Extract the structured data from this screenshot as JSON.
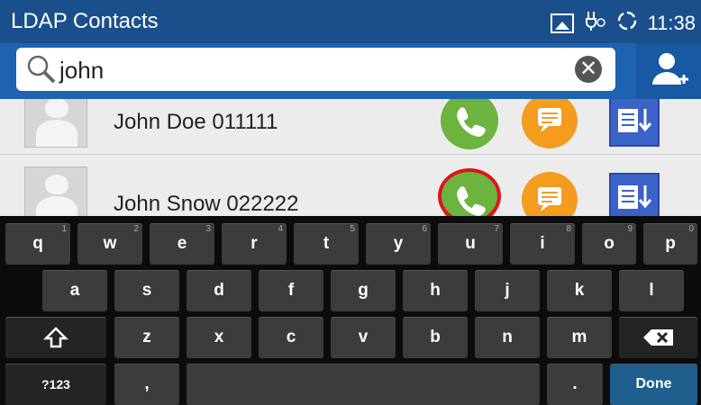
{
  "status_bar": {
    "title": "LDAP Contacts",
    "time": "11:38"
  },
  "search": {
    "query": "john"
  },
  "contacts": [
    {
      "name": "John Doe 011111"
    },
    {
      "name": "John Snow 022222"
    }
  ],
  "keyboard": {
    "row1": [
      {
        "label": "q",
        "hint": "1"
      },
      {
        "label": "w",
        "hint": "2"
      },
      {
        "label": "e",
        "hint": "3"
      },
      {
        "label": "r",
        "hint": "4"
      },
      {
        "label": "t",
        "hint": "5"
      },
      {
        "label": "y",
        "hint": "6"
      },
      {
        "label": "u",
        "hint": "7"
      },
      {
        "label": "i",
        "hint": "8"
      },
      {
        "label": "o",
        "hint": "9"
      },
      {
        "label": "p",
        "hint": "0"
      }
    ],
    "row2": [
      "a",
      "s",
      "d",
      "f",
      "g",
      "h",
      "j",
      "k",
      "l"
    ],
    "row3": [
      "z",
      "x",
      "c",
      "v",
      "b",
      "n",
      "m"
    ],
    "symbols_label": "?123",
    "comma_label": ",",
    "period_label": ".",
    "done_label": "Done"
  },
  "colors": {
    "status_bar": "#1b4f8c",
    "search_bar": "#1e63b0",
    "call_green": "#6cb33f",
    "message_orange": "#f39c1e",
    "download_blue": "#3b62c8",
    "highlight_red": "#e0141b"
  },
  "icons": [
    "image-icon",
    "usb-debug-icon",
    "sync-icon",
    "search-icon",
    "clear-icon",
    "add-contact-icon",
    "avatar-icon",
    "phone-icon",
    "message-icon",
    "download-contact-icon",
    "shift-icon",
    "backspace-icon"
  ]
}
